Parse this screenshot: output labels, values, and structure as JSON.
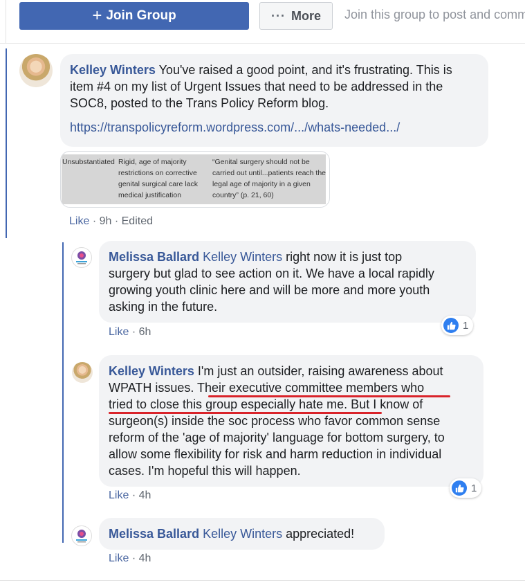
{
  "header": {
    "join_label": "Join Group",
    "join_icon": "plus-icon",
    "more_label": "More",
    "more_icon": "ellipsis-icon",
    "hint": "Join this group to post and comm"
  },
  "comments": [
    {
      "author": "Kelley Winters",
      "text": "You've raised a good point, and it's frustrating. This is item #4 on my list of Urgent Issues that need to be addressed in the SOC8, posted to the Trans Policy Reform blog.",
      "link": "https://transpolicyreform.wordpress.com/.../whats-needed.../",
      "attachment": {
        "col1": "Unsubstantiated",
        "col2": [
          "Rigid, age of majority",
          "restrictions on corrective",
          "genital surgical care lack",
          "medical justification"
        ],
        "col3": [
          "“Genital surgery should not be",
          "carried out until...patients reach the",
          "legal age of majority in a given",
          "country” (p. 21, 60)"
        ]
      },
      "actions": {
        "like": "Like",
        "time": "9h",
        "edited": "Edited"
      }
    }
  ],
  "replies": [
    {
      "author": "Melissa Ballard",
      "mention": "Kelley Winters",
      "lines": [
        " right now it is just top",
        "surgery but glad to see action on it. We have a local rapidly",
        "growing youth clinic here and will be more and more youth",
        "asking in the future."
      ],
      "actions": {
        "like": "Like",
        "time": "6h"
      },
      "reactions": "1"
    },
    {
      "author": "Kelley Winters",
      "lines": [
        " I'm just an outsider, raising awareness about",
        "WPATH issues. Their executive committee members who",
        "tried to close this group especially hate me. But I know of",
        "surgeon(s) inside the soc process who favor common sense",
        "reform of the 'age of majority' language for bottom surgery, to",
        "allow some flexibility for risk and harm reduction in individual",
        "cases. I'm hopeful this will happen."
      ],
      "actions": {
        "like": "Like",
        "time": "4h"
      },
      "reactions": "1"
    },
    {
      "author": "Melissa Ballard",
      "mention": "Kelley Winters",
      "text": " appreciated!",
      "actions": {
        "like": "Like",
        "time": "4h"
      }
    }
  ],
  "colors": {
    "accent": "#4267b2",
    "link": "#385898",
    "underline": "#d9232a",
    "bubble": "#f2f3f5"
  }
}
